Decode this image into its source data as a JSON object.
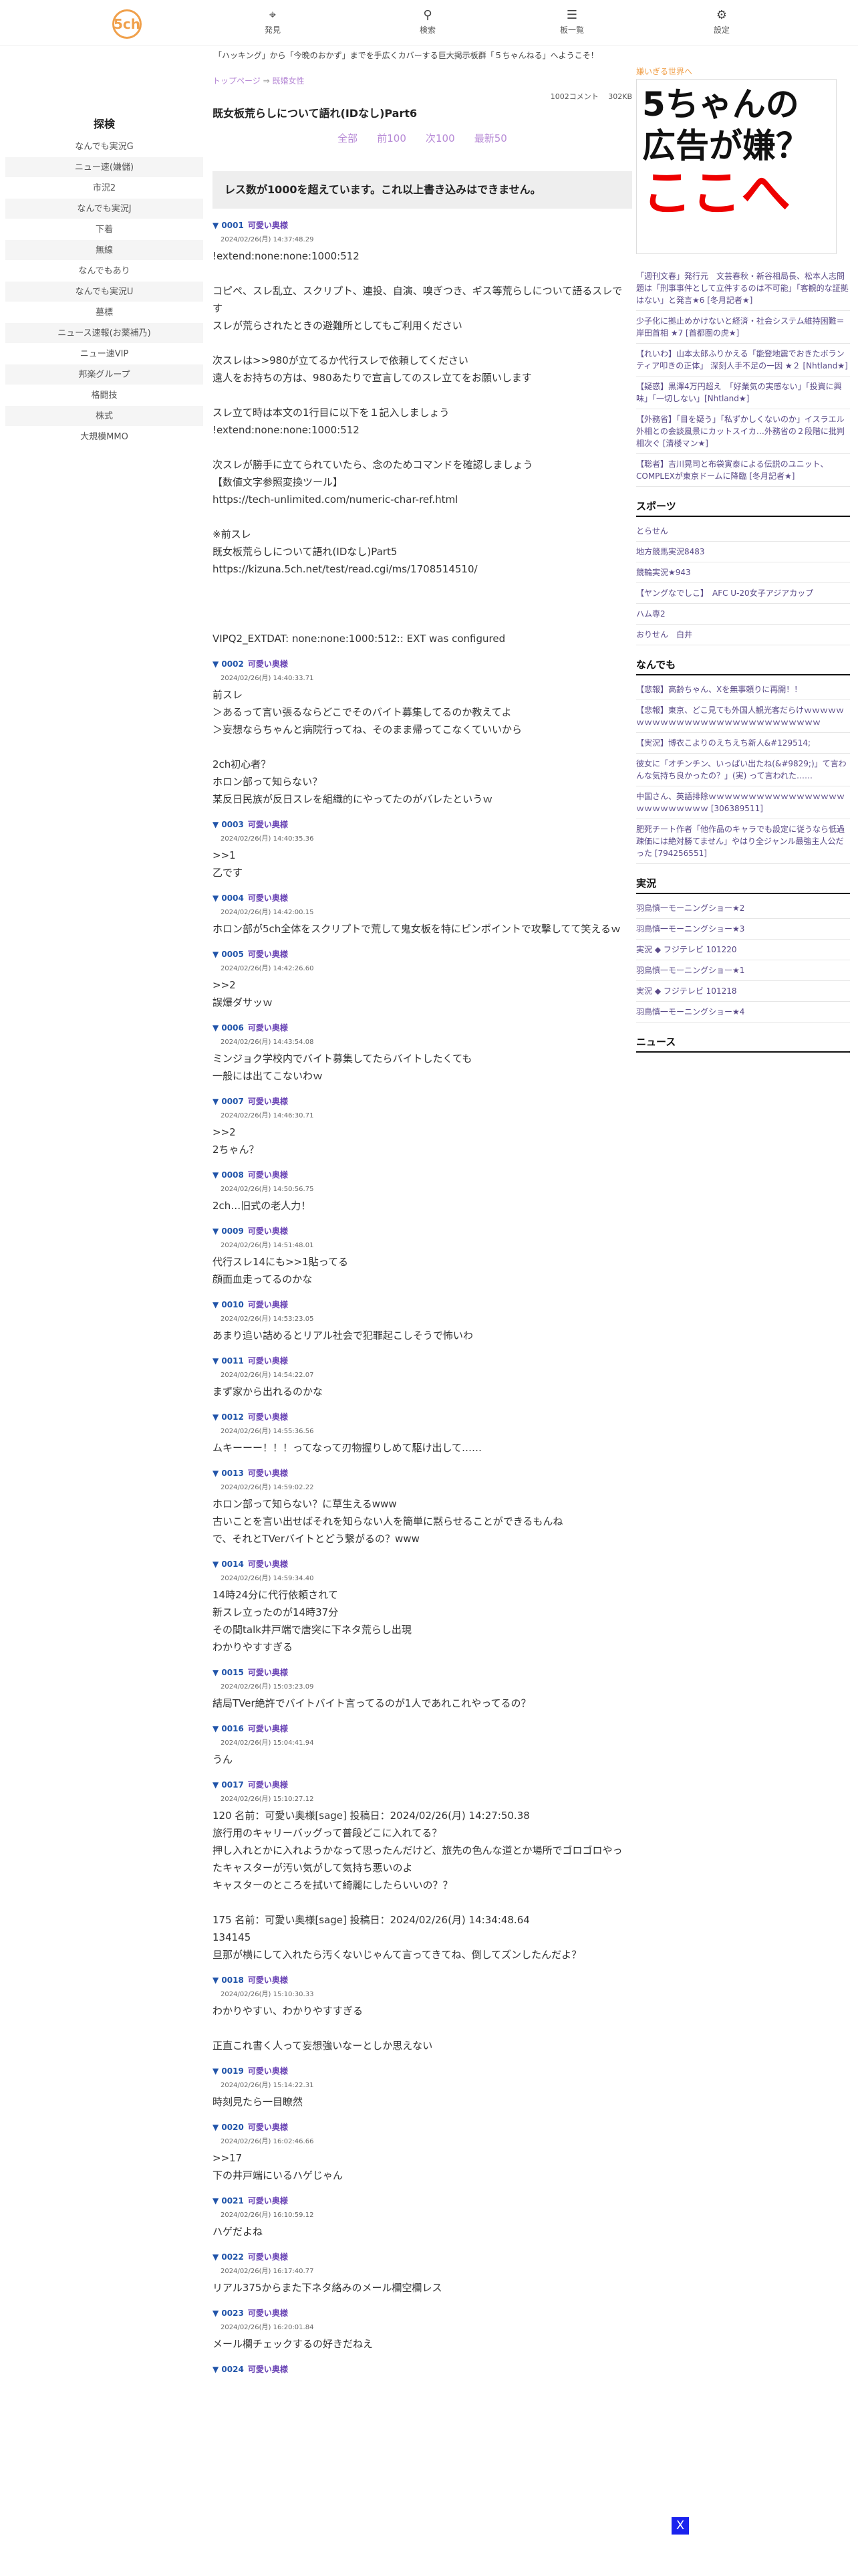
{
  "header": {
    "logo": "5ch",
    "nav": [
      {
        "label": "発見",
        "icon": "discover-icon"
      },
      {
        "label": "検索",
        "icon": "search-icon"
      },
      {
        "label": "板一覧",
        "icon": "boards-icon"
      },
      {
        "label": "設定",
        "icon": "settings-icon"
      }
    ],
    "marquee": "「ハッキング」から「今晩のおかず」までを手広くカバーする巨大掲示板群「５ちゃんねる」へようこそ！"
  },
  "sidebar": {
    "title": "探検",
    "items": [
      "なんでも実況G",
      "ニュー速(嫌儲)",
      "市況2",
      "なんでも実況J",
      "下着",
      "無線",
      "なんでもあり",
      "なんでも実況U",
      "墓標",
      "ニュース速報(お薬補乃)",
      "ニュー速VIP",
      "邦楽グループ",
      "格闘技",
      "株式",
      "大規模MMO"
    ]
  },
  "thread": {
    "crumb_top": "トップページ",
    "crumb_sep": "⇒",
    "crumb_board": "既婚女性",
    "meta": "1002コメント　  302KB",
    "title": "既女板荒らしについて語れ(IDなし)Part6",
    "pager": [
      "全部",
      "前100",
      "次100",
      "最新50"
    ],
    "warning": "レス数が1000を超えています。これ以上書き込みはできません。"
  },
  "posts": [
    {
      "num": "0001",
      "name": "可愛い奥様",
      "date": "2024/02/26(月) 14:37:48.29",
      "body": "!extend:none:none:1000:512\n\nコピペ、スレ乱立、スクリプト、連投、自演、嗅ぎつき、ギス等荒らしについて語るスレです\nスレが荒らされたときの避難所としてもご利用ください\n\n次スレは>>980が立てるか代行スレで依頼してください\n遠人をお持ちの方は、980あたりで宣言してのスレ立てをお願いします\n\nスレ立て時は本文の1行目に以下を１記入しましょう\n!extend:none:none:1000:512\n\n次スレが勝手に立てられていたら、念のためコマンドを確認しましょう\n【数値文字参照変換ツール】\nhttps://tech-unlimited.com/numeric-char-ref.html\n\n※前スレ\n既女板荒らしについて語れ(IDなし)Part5\nhttps://kizuna.5ch.net/test/read.cgi/ms/1708514510/\n\n\n\nVIPQ2_EXTDAT: none:none:1000:512:: EXT was configured"
    },
    {
      "num": "0002",
      "name": "可愛い奥様",
      "date": "2024/02/26(月) 14:40:33.71",
      "body": "前スレ\n＞あるって言い張るならどこでそのバイト募集してるのか教えてよ\n＞妄想ならちゃんと病院行ってね、そのまま帰ってこなくていいから\n\n2ch初心者？\nホロン部って知らない？\n某反日民族が反日スレを組織的にやってたのがバレたというｗ"
    },
    {
      "num": "0003",
      "name": "可愛い奥様",
      "date": "2024/02/26(月) 14:40:35.36",
      "body": ">>1\n乙です"
    },
    {
      "num": "0004",
      "name": "可愛い奥様",
      "date": "2024/02/26(月) 14:42:00.15",
      "body": "ホロン部が5ch全体をスクリプトで荒して鬼女板を特にピンポイントで攻撃してて笑えるｗ"
    },
    {
      "num": "0005",
      "name": "可愛い奥様",
      "date": "2024/02/26(月) 14:42:26.60",
      "body": ">>2\n誤爆ダサッｗ"
    },
    {
      "num": "0006",
      "name": "可愛い奥様",
      "date": "2024/02/26(月) 14:43:54.08",
      "body": "ミンジョク学校内でバイト募集してたらバイトしたくても\n一般には出てこないわｗ"
    },
    {
      "num": "0007",
      "name": "可愛い奥様",
      "date": "2024/02/26(月) 14:46:30.71",
      "body": ">>2\n2ちゃん？"
    },
    {
      "num": "0008",
      "name": "可愛い奥様",
      "date": "2024/02/26(月) 14:50:56.75",
      "body": "2ch…旧式の老人力！"
    },
    {
      "num": "0009",
      "name": "可愛い奥様",
      "date": "2024/02/26(月) 14:51:48.01",
      "body": "代行スレ14にも>>1貼ってる\n顔面血走ってるのかな"
    },
    {
      "num": "0010",
      "name": "可愛い奥様",
      "date": "2024/02/26(月) 14:53:23.05",
      "body": "あまり追い詰めるとリアル社会で犯罪起こしそうで怖いわ"
    },
    {
      "num": "0011",
      "name": "可愛い奥様",
      "date": "2024/02/26(月) 14:54:22.07",
      "body": "まず家から出れるのかな"
    },
    {
      "num": "0012",
      "name": "可愛い奥様",
      "date": "2024/02/26(月) 14:55:36.56",
      "body": "ムキーーー！！！ってなって刃物握りしめて駆け出して……"
    },
    {
      "num": "0013",
      "name": "可愛い奥様",
      "date": "2024/02/26(月) 14:59:02.22",
      "body": "ホロン部って知らない？に草生えるwww\n古いことを言い出せばそれを知らない人を簡単に黙らせることができるもんね\nで、それとTVerバイトとどう繋がるの？www"
    },
    {
      "num": "0014",
      "name": "可愛い奥様",
      "date": "2024/02/26(月) 14:59:34.40",
      "body": "14時24分に代行依頼されて\n新スレ立ったのが14時37分\nその間talk井戸端で唐突に下ネタ荒らし出現\nわかりやすすぎる"
    },
    {
      "num": "0015",
      "name": "可愛い奥様",
      "date": "2024/02/26(月) 15:03:23.09",
      "body": "結局TVer絶許でバイトバイト言ってるのが1人であれこれやってるの？"
    },
    {
      "num": "0016",
      "name": "可愛い奥様",
      "date": "2024/02/26(月) 15:04:41.94",
      "body": "うん"
    },
    {
      "num": "0017",
      "name": "可愛い奥様",
      "date": "2024/02/26(月) 15:10:27.12",
      "body": "120 名前：可愛い奥様[sage] 投稿日：2024/02/26(月) 14:27:50.38\n旅行用のキャリーバッグって普段どこに入れてる？\n押し入れとかに入れようかなって思ったんだけど、旅先の色んな道とか場所でゴロゴロやったキャスターが汚い気がして気持ち悪いのよ\nキャスターのところを拭いて綺麗にしたらいいの？？\n\n175 名前：可愛い奥様[sage] 投稿日：2024/02/26(月) 14:34:48.64\n134145\n旦那が横にして入れたら汚くないじゃんて言ってきてね、倒してズンしたんだよ？"
    },
    {
      "num": "0018",
      "name": "可愛い奥様",
      "date": "2024/02/26(月) 15:10:30.33",
      "body": "わかりやすい、わかりやすすぎる\n\n正直これ書く人って妄想強いなーとしか思えない"
    },
    {
      "num": "0019",
      "name": "可愛い奥様",
      "date": "2024/02/26(月) 15:14:22.31",
      "body": "時刻見たら一目瞭然"
    },
    {
      "num": "0020",
      "name": "可愛い奥様",
      "date": "2024/02/26(月) 16:02:46.66",
      "body": ">>17\n下の井戸端にいるハゲじゃん"
    },
    {
      "num": "0021",
      "name": "可愛い奥様",
      "date": "2024/02/26(月) 16:10:59.12",
      "body": "ハゲだよね"
    },
    {
      "num": "0022",
      "name": "可愛い奥様",
      "date": "2024/02/26(月) 16:17:40.77",
      "body": "リアル375からまた下ネタ絡みのメール欄空欄レス"
    },
    {
      "num": "0023",
      "name": "可愛い奥様",
      "date": "2024/02/26(月) 16:20:01.84",
      "body": "メール欄チェックするの好きだねえ"
    },
    {
      "num": "0024",
      "name": "可愛い奥様",
      "date": "",
      "body": ""
    }
  ],
  "right": {
    "ad_caption": "嫌いぎる世界へ",
    "ad_line1": "5ちゃんの",
    "ad_line2": "広告が嫌？",
    "ad_line3": "ここへ",
    "sections": [
      {
        "title": "",
        "rows": [
          "「週刊文春」発行元　文芸春秋・新谷相局長、松本人志問題は「刑事事件として立件するのは不可能」「客観的な証拠はない」と発言★6 [冬月記者★]",
          "少子化に拠止めかけないと経済・社会システム維持困難＝岸田首相 ★7 [首都圏の虎★]",
          "【れいわ】山本太郎ふりかえる「能登地震でおきたボランティア叩きの正体」 深刻人手不足の一因 ★２ [Nhtland★]",
          "【疑惑】黒澤4万円超え　「好業気の実感ない」「投資に興味」「一切しない」[Nhtland★]",
          "【外務省】「目を疑う」「私ずかしくないのか」イスラエル外相との会談風景にカットスイカ…外務省の２段階に批判相次ぐ [清楼マン★]",
          "【聡者】吉川晃司と布袋寅泰による伝説のユニット、COMPLEXが東京ドームに降臨 [冬月記者★]"
        ]
      },
      {
        "title": "スポーツ",
        "rows": [
          "とらせん",
          "地方競馬実況8483",
          "競輪実況★943",
          "【ヤングなでしこ】　AFC U-20女子アジアカップ",
          "ハム専2",
          "おりせん　白井"
        ]
      },
      {
        "title": "なんでも",
        "rows": [
          "【悲報】高齢ちゃん、Xを無事頼りに再開！！",
          "【悲報】東京、どこ見ても外国人観光客だらけｗｗｗｗｗｗｗｗｗｗｗｗｗｗｗｗｗｗｗｗｗｗｗｗｗｗｗｗ",
          "【実況】博衣こよりのえちえち新人&#129514;",
          "彼女に「オチンチン、いっぱい出たね(&#9829;)」て言わんな気持ち良かったの？」(実) って言われた……",
          "中国さん、英語排除ｗｗｗｗｗｗｗｗｗｗｗｗｗｗｗｗｗｗｗｗｗｗｗｗｗｗ [306389511]",
          "肥死チート作者「他作品のキャラでも設定に従うなら低過疎価には絶対勝てません」やはり全ジャンル最強主人公だった [794256551]"
        ]
      },
      {
        "title": "実況",
        "rows": [
          "羽鳥慎一モーニングショー★2",
          "羽鳥慎一モーニングショー★3",
          "実況 ◆ フジテレビ 101220",
          "羽鳥慎一モーニングショー★1",
          "実況 ◆ フジテレビ 101218",
          "羽鳥慎一モーニングショー★4"
        ]
      },
      {
        "title": "ニュース",
        "rows": []
      }
    ]
  },
  "close_button": "X"
}
